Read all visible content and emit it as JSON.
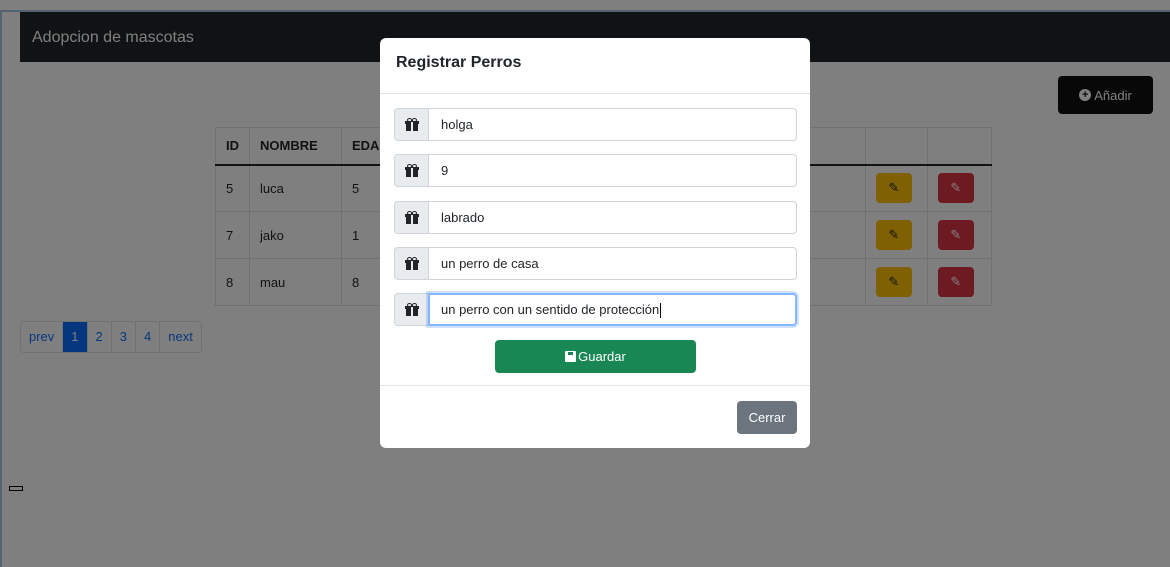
{
  "navbar": {
    "brand": "Adopcion de mascotas"
  },
  "toolbar": {
    "add_label": "Añadir",
    "add_icon": "plus-circle-icon"
  },
  "table": {
    "headers": [
      "ID",
      "NOMBRE",
      "EDAD"
    ],
    "rows": [
      {
        "id": "5",
        "nombre": "luca",
        "edad": "5"
      },
      {
        "id": "7",
        "nombre": "jako",
        "edad": "1"
      },
      {
        "id": "8",
        "nombre": "mau",
        "edad": "8"
      }
    ],
    "edit_icon": "edit-icon",
    "delete_icon": "edit-icon"
  },
  "pagination": {
    "prev": "prev",
    "pages": [
      "1",
      "2",
      "3",
      "4"
    ],
    "next": "next",
    "active": "1"
  },
  "modal": {
    "title": "Registrar Perros",
    "fields": [
      {
        "value": "holga",
        "icon": "gift-icon"
      },
      {
        "value": "9",
        "icon": "gift-icon"
      },
      {
        "value": "labrado",
        "icon": "gift-icon"
      },
      {
        "value": "un perro de casa",
        "icon": "gift-icon"
      },
      {
        "value": "un perro con un sentido de protección",
        "icon": "gift-icon"
      }
    ],
    "save_label": "Guardar",
    "close_label": "Cerrar"
  },
  "colors": {
    "navbar": "#212529",
    "primary": "#0d6efd",
    "success": "#198754",
    "warning": "#ffc107",
    "danger": "#dc3545",
    "secondary": "#6c757d"
  }
}
